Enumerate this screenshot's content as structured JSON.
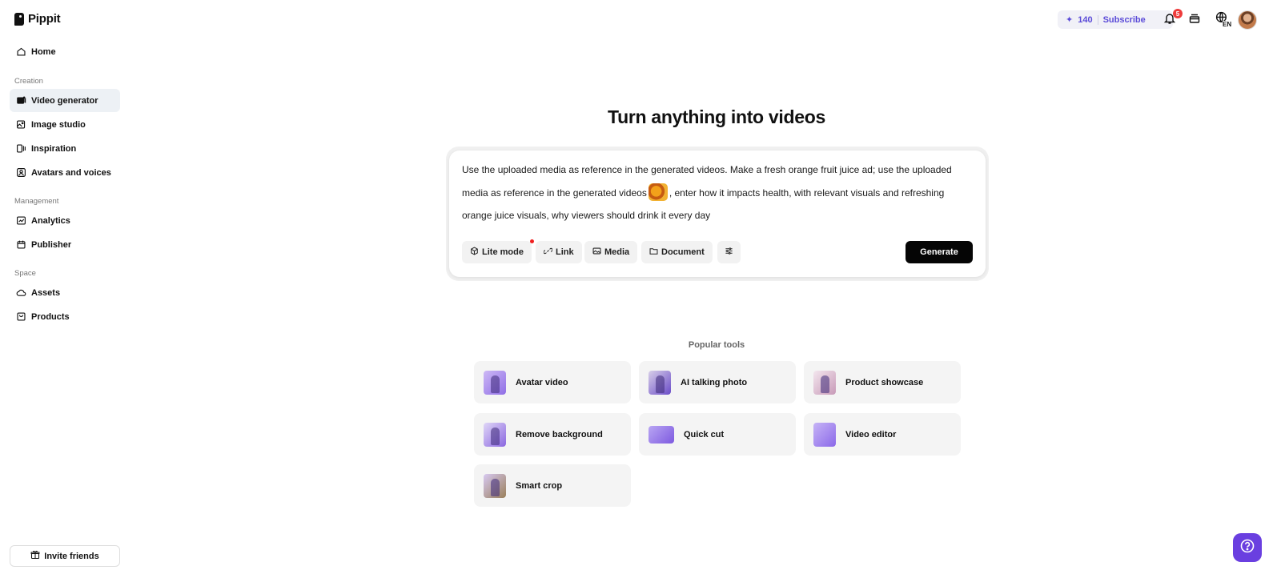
{
  "app": {
    "name": "Pippit"
  },
  "sidebar": {
    "home": "Home",
    "sections": {
      "creation": "Creation",
      "management": "Management",
      "space": "Space"
    },
    "creation_items": [
      {
        "label": "Video generator",
        "icon": "video-generator-icon",
        "active": true
      },
      {
        "label": "Image studio",
        "icon": "image-studio-icon"
      },
      {
        "label": "Inspiration",
        "icon": "inspiration-icon"
      },
      {
        "label": "Avatars and voices",
        "icon": "avatar-icon"
      }
    ],
    "management_items": [
      {
        "label": "Analytics",
        "icon": "analytics-icon"
      },
      {
        "label": "Publisher",
        "icon": "calendar-icon"
      }
    ],
    "space_items": [
      {
        "label": "Assets",
        "icon": "cloud-icon"
      },
      {
        "label": "Products",
        "icon": "product-icon"
      }
    ],
    "invite_label": "Invite friends"
  },
  "topbar": {
    "credits": "140",
    "subscribe": "Subscribe",
    "notification_count": "5",
    "language": "EN"
  },
  "main": {
    "headline": "Turn anything into videos",
    "prompt": {
      "text_before": "Use the uploaded media as reference in the generated videos. Make a fresh orange fruit juice ad; use the uploaded media as reference in the generated videos",
      "text_after": ", enter how it impacts health, with relevant visuals and refreshing orange juice visuals, why viewers should drink it every day"
    },
    "toolbar": {
      "lite_mode": "Lite mode",
      "link": "Link",
      "media": "Media",
      "document": "Document",
      "generate": "Generate"
    },
    "popular_tools_label": "Popular tools",
    "tools": [
      {
        "label": "Avatar video"
      },
      {
        "label": "AI talking photo"
      },
      {
        "label": "Product showcase"
      },
      {
        "label": "Remove background"
      },
      {
        "label": "Quick cut"
      },
      {
        "label": "Video editor"
      },
      {
        "label": "Smart crop"
      }
    ]
  },
  "colors": {
    "accent": "#5b4bd8",
    "help_button": "#6a3fe0",
    "generate_button": "#050505",
    "active_nav": "#edf1f5"
  }
}
